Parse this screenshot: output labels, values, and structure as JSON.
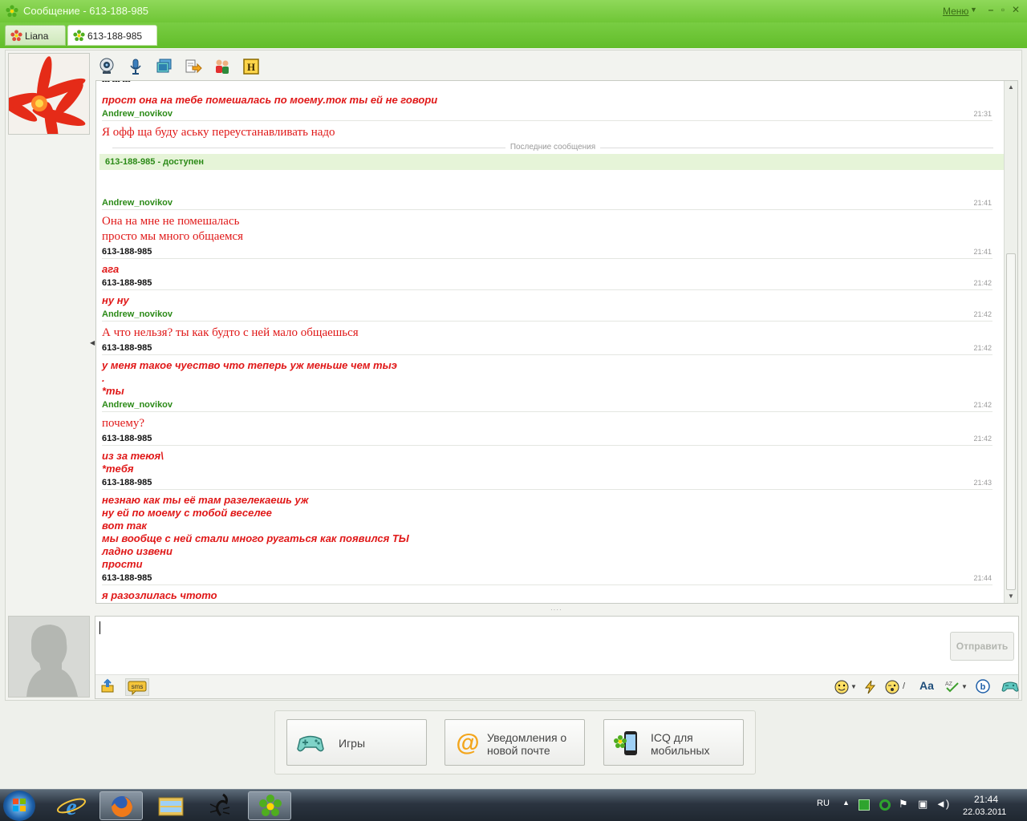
{
  "window": {
    "title": "Сообщение - 613-188-985",
    "menu_label": "Меню",
    "min_icon": "minimize-icon",
    "max_icon": "maximize-icon",
    "close_icon": "close-icon"
  },
  "tabs": [
    {
      "label": "Liana",
      "icon": "icq-flower-red-icon",
      "active": false
    },
    {
      "label": "613-188-985",
      "icon": "icq-flower-green-icon",
      "active": true
    }
  ],
  "toolbar": {
    "icons": [
      "webcam-icon",
      "microphone-icon",
      "screenshot-icon",
      "send-file-icon",
      "add-contact-icon",
      "history-icon"
    ],
    "history_letter": "H"
  },
  "chat": {
    "top_partial": "--- --- ---",
    "messages": [
      {
        "text": [
          "прост она на тебе помешалась по моему.ток ты ей не говори"
        ],
        "style": "italic"
      },
      {
        "sender": "Andrew_novikov",
        "sender_color": "green",
        "time": "21:31"
      },
      {
        "text": [
          "Я офф ща буду аську переустанавливать надо"
        ],
        "style": "serif"
      }
    ],
    "last_messages_label": "Последние сообщения",
    "status_text": "613-188-985 - доступен",
    "thread": [
      {
        "sender": "Andrew_novikov",
        "color": "green",
        "time": "21:41",
        "lines": [
          "Она на мне не помешалась",
          "просто мы много общаемся"
        ],
        "style": "serif"
      },
      {
        "sender": "613-188-985",
        "color": "black",
        "time": "21:41",
        "lines": [
          "ага"
        ],
        "style": "italic"
      },
      {
        "sender": "613-188-985",
        "color": "black",
        "time": "21:42",
        "lines": [
          "ну ну"
        ],
        "style": "italic"
      },
      {
        "sender": "Andrew_novikov",
        "color": "green",
        "time": "21:42",
        "lines": [
          "А что нельзя? ты как будто с ней мало общаешься"
        ],
        "style": "serif"
      },
      {
        "sender": "613-188-985",
        "color": "black",
        "time": "21:42",
        "lines": [
          "у меня такое чуество что теперь уж меньше чем тыэ",
          ".",
          "*ты"
        ],
        "style": "italic"
      },
      {
        "sender": "Andrew_novikov",
        "color": "green",
        "time": "21:42",
        "lines": [
          "почему?"
        ],
        "style": "serif"
      },
      {
        "sender": "613-188-985",
        "color": "black",
        "time": "21:42",
        "lines": [
          "из за теюя\\",
          "*тебя"
        ],
        "style": "italic"
      },
      {
        "sender": "613-188-985",
        "color": "black",
        "time": "21:43",
        "lines": [
          "незнаю как ты её там разелекаешь уж",
          "ну ей по моему с тобой веселее",
          "вот так",
          "мы вообще с ней стали много ругаться как появился ТЫ",
          "ладно извени",
          "прости"
        ],
        "style": "italic"
      },
      {
        "sender": "613-188-985",
        "color": "black",
        "time": "21:44",
        "lines": [
          "я разозлилась чтото"
        ],
        "style": "italic"
      }
    ]
  },
  "input": {
    "send_label": "Отправить",
    "sms_label": "sms",
    "toolbar_icons": [
      "smiley-icon",
      "lightning-icon",
      "wink-icon",
      "font-icon",
      "spellcheck-icon",
      "b-icon",
      "gamepad-icon"
    ],
    "font_label": "Aa"
  },
  "promos": [
    {
      "label": "Игры",
      "icon": "gamepad-icon"
    },
    {
      "label": "Уведомления о новой почте",
      "line1": "Уведомления о",
      "line2": "новой почте",
      "icon": "at-mail-icon"
    },
    {
      "label": "ICQ для мобильных",
      "line1": "ICQ для",
      "line2": "мобильных",
      "icon": "mobile-phone-icon"
    }
  ],
  "taskbar": {
    "lang": "RU",
    "time": "21:44",
    "date": "22.03.2011",
    "items": [
      "start-orb-icon",
      "internet-explorer-icon",
      "firefox-icon",
      "windows-explorer-icon",
      "scorpion-app-icon",
      "icq-taskbar-icon"
    ]
  }
}
